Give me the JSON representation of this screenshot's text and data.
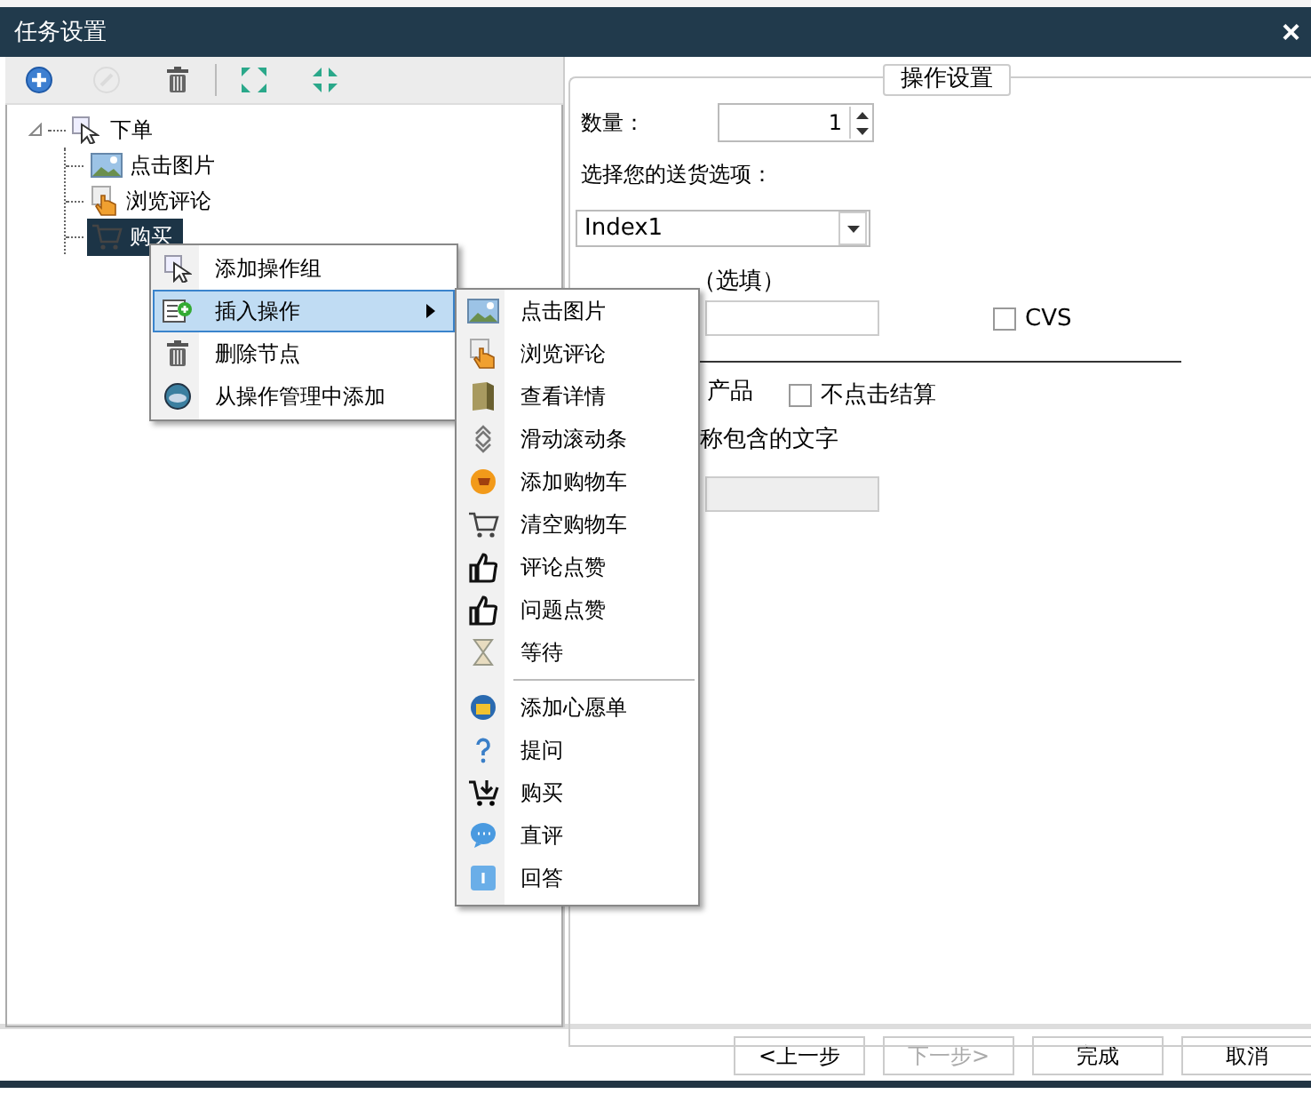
{
  "window": {
    "title": "任务设置",
    "close": "×"
  },
  "toolbar": [
    {
      "kind": "add",
      "disabled": false
    },
    {
      "kind": "edit",
      "disabled": true
    },
    {
      "kind": "delete",
      "disabled": false
    },
    {
      "kind": "expand",
      "disabled": false
    },
    {
      "kind": "collapse",
      "disabled": false
    }
  ],
  "tree": {
    "label": "下单",
    "kind": "pointer",
    "expanded": true,
    "selected": false,
    "children": [
      {
        "label": "点击图片",
        "kind": "image",
        "selected": false
      },
      {
        "label": "浏览评论",
        "kind": "hand",
        "selected": false
      },
      {
        "label": "购买",
        "kind": "cart",
        "selected": true
      }
    ]
  },
  "context_menu": [
    {
      "label": "添加操作组",
      "kind": "pointer",
      "selected": false,
      "submenu": false
    },
    {
      "label": "插入操作",
      "kind": "insert",
      "selected": true,
      "submenu": true
    },
    {
      "label": "删除节点",
      "kind": "delete",
      "selected": false,
      "submenu": false
    },
    {
      "label": "从操作管理中添加",
      "kind": "globe",
      "selected": false,
      "submenu": false
    }
  ],
  "submenu": [
    [
      {
        "label": "点击图片",
        "kind": "image"
      },
      {
        "label": "浏览评论",
        "kind": "hand"
      },
      {
        "label": "查看详情",
        "kind": "book"
      },
      {
        "label": "滑动滚动条",
        "kind": "scroll"
      },
      {
        "label": "添加购物车",
        "kind": "orange"
      },
      {
        "label": "清空购物车",
        "kind": "cart"
      },
      {
        "label": "评论点赞",
        "kind": "thumb"
      },
      {
        "label": "问题点赞",
        "kind": "thumb"
      },
      {
        "label": "等待",
        "kind": "hourglass"
      }
    ],
    [
      {
        "label": "添加心愿单",
        "kind": "gift"
      },
      {
        "label": "提问",
        "kind": "question"
      },
      {
        "label": "购买",
        "kind": "buy"
      },
      {
        "label": "直评",
        "kind": "bubble"
      },
      {
        "label": "回答",
        "kind": "info"
      }
    ]
  ],
  "settings": {
    "legend": "操作设置",
    "quantity_label": "数量：",
    "quantity": "1",
    "shipping_label": "选择您的送货选项：",
    "shipping": "Index1",
    "asin_label": "（选填）",
    "cvs": {
      "label": "CVS",
      "checked": false
    },
    "product_label": "产品",
    "no_checkout": {
      "label": "不点击结算",
      "checked": false
    },
    "contains_label": "称包含的文字"
  },
  "buttons": [
    {
      "label": "<上一步",
      "disabled": false
    },
    {
      "label": "下一步>",
      "disabled": true
    },
    {
      "label": "完成",
      "disabled": false
    },
    {
      "label": "取消",
      "disabled": false
    }
  ]
}
